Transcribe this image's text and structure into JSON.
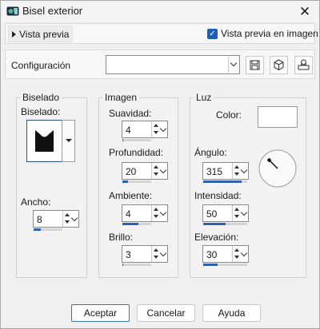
{
  "window": {
    "title": "Bisel exterior",
    "close_glyph": "✕"
  },
  "preview": {
    "toggle_label": "Vista previa",
    "checkbox_label": "Vista previa en imagen",
    "checkbox_checked": true
  },
  "config": {
    "label": "Configuración",
    "value": "",
    "buttons": [
      "save-icon",
      "reset-icon",
      "randomize-icon"
    ]
  },
  "biselado": {
    "group_label": "Biselado",
    "shape_label": "Biselado:",
    "ancho_label": "Ancho:",
    "ancho_value": "8",
    "ancho_level": 0.25
  },
  "imagen": {
    "group_label": "Imagen",
    "suavidad_label": "Suavidad:",
    "suavidad_value": "4",
    "suavidad_level": 0.04,
    "profundidad_label": "Profundidad:",
    "profundidad_value": "20",
    "profundidad_level": 0.2,
    "ambiente_label": "Ambiente:",
    "ambiente_value": "4",
    "ambiente_level": 0.55,
    "brillo_label": "Brillo:",
    "brillo_value": "3",
    "brillo_level": 0.03
  },
  "luz": {
    "group_label": "Luz",
    "color_label": "Color:",
    "color_value": "#ffffff",
    "angulo_label": "Ángulo:",
    "angulo_value": "315",
    "angulo_level": 0.88,
    "intensidad_label": "Intensidad:",
    "intensidad_value": "50",
    "intensidad_level": 0.5,
    "elevacion_label": "Elevación:",
    "elevacion_value": "30",
    "elevacion_level": 0.33
  },
  "footer": {
    "accept_label": "Aceptar",
    "cancel_label": "Cancelar",
    "help_label": "Ayuda"
  },
  "colors": {
    "accent": "#2b62b7"
  }
}
